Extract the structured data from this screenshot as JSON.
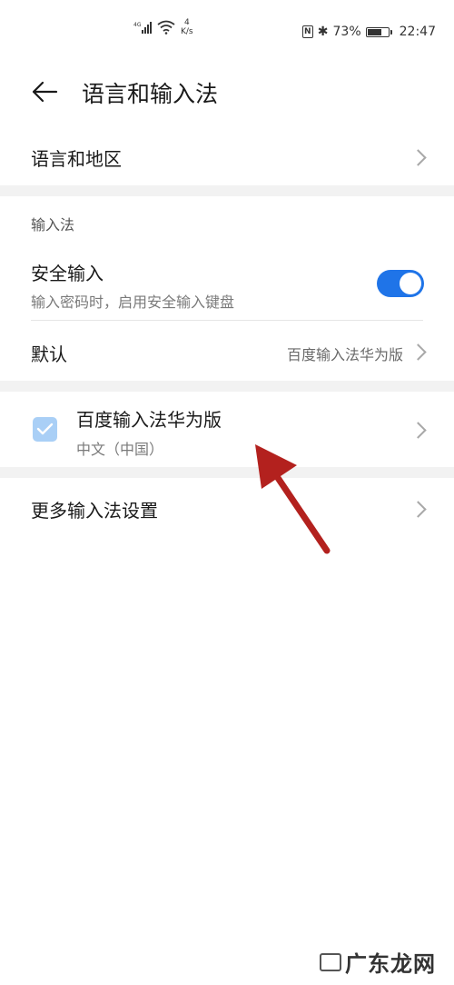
{
  "status_bar": {
    "network": "4G",
    "speed_value": "4",
    "speed_unit": "K/s",
    "nfc": "N",
    "battery_percent": "73%",
    "time": "22:47",
    "battery_level": 0.73
  },
  "header": {
    "title": "语言和输入法"
  },
  "language_region": {
    "label": "语言和地区"
  },
  "input_section": {
    "heading": "输入法",
    "secure_input": {
      "title": "安全输入",
      "subtitle": "输入密码时，启用安全输入键盘",
      "enabled": true
    },
    "default": {
      "label": "默认",
      "value": "百度输入法华为版"
    }
  },
  "input_method": {
    "name": "百度输入法华为版",
    "language": "中文（中国）",
    "checked": true
  },
  "more_settings": {
    "label": "更多输入法设置"
  },
  "watermark": {
    "text": "广东龙网"
  },
  "colors": {
    "accent": "#1f74e8",
    "checkbox": "#a9cff6",
    "annotation_arrow": "#b3211e"
  }
}
